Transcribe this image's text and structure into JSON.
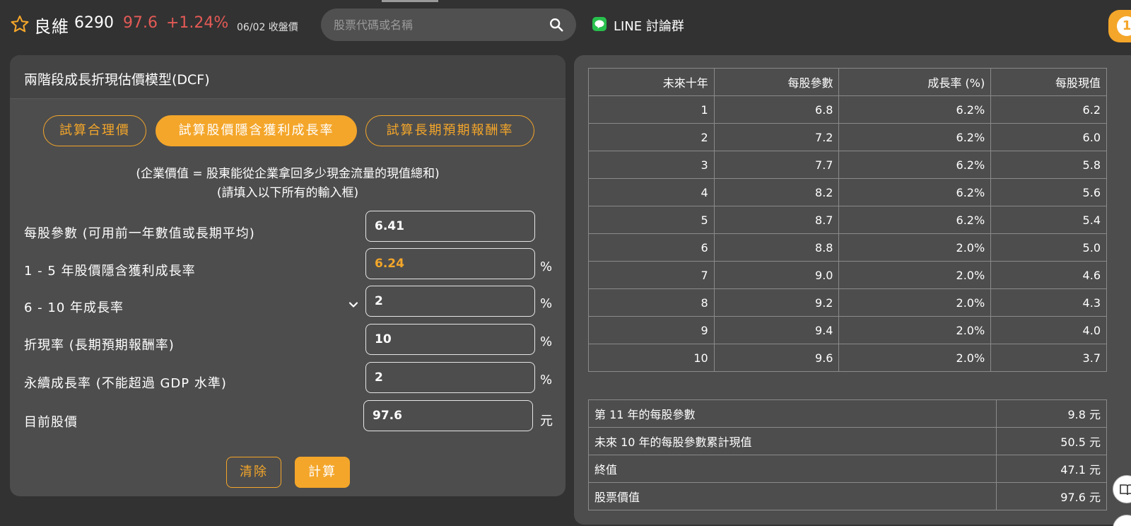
{
  "header": {
    "stock_name": "良維",
    "stock_code": "6290",
    "price": "97.6",
    "change": "+1.24%",
    "close_date": "06/02 收盤價",
    "search_placeholder": "股票代碼或名稱",
    "line_label": "LINE 討論群",
    "badge": "1",
    "price_color": "#e35a56",
    "accent_color": "#f4a62a"
  },
  "model": {
    "title": "兩階段成長折現估價模型(DCF)",
    "tabs": [
      {
        "label": "試算合理價",
        "active": false
      },
      {
        "label": "試算股價隱含獲利成長率",
        "active": true
      },
      {
        "label": "試算長期預期報酬率",
        "active": false
      }
    ],
    "description_1": "(企業價值 = 股東能從企業拿回多少現金流量的現值總和)",
    "description_2": "(請填入以下所有的輸入框)",
    "fields": [
      {
        "label": "每股參數 (可用前一年數值或長期平均)",
        "value": "6.41",
        "unit": ""
      },
      {
        "label": "1 - 5 年股價隱含獲利成長率",
        "value": "6.24",
        "unit": "%"
      },
      {
        "label": "6 - 10 年成長率",
        "value": "2",
        "unit": "%"
      },
      {
        "label": "折現率 (長期預期報酬率)",
        "value": "10",
        "unit": "%"
      },
      {
        "label": "永續成長率 (不能超過 GDP 水準)",
        "value": "2",
        "unit": "%"
      },
      {
        "label": "目前股價",
        "value": "97.6",
        "unit": "元"
      }
    ],
    "clear_label": "清除",
    "calc_label": "計算"
  },
  "table": {
    "headers": [
      "未來十年",
      "每股參數",
      "成長率 (%)",
      "每股現值"
    ],
    "rows": [
      [
        "1",
        "6.8",
        "6.2%",
        "6.2"
      ],
      [
        "2",
        "7.2",
        "6.2%",
        "6.0"
      ],
      [
        "3",
        "7.7",
        "6.2%",
        "5.8"
      ],
      [
        "4",
        "8.2",
        "6.2%",
        "5.6"
      ],
      [
        "5",
        "8.7",
        "6.2%",
        "5.4"
      ],
      [
        "6",
        "8.8",
        "2.0%",
        "5.0"
      ],
      [
        "7",
        "9.0",
        "2.0%",
        "4.6"
      ],
      [
        "8",
        "9.2",
        "2.0%",
        "4.3"
      ],
      [
        "9",
        "9.4",
        "2.0%",
        "4.0"
      ],
      [
        "10",
        "9.6",
        "2.0%",
        "3.7"
      ]
    ]
  },
  "summary": [
    {
      "label": "第 11 年的每股參數",
      "value": "9.8 元"
    },
    {
      "label": "未來 10 年的每股參數累計現值",
      "value": "50.5 元"
    },
    {
      "label": "終值",
      "value": "47.1 元"
    },
    {
      "label": "股票價值",
      "value": "97.6 元"
    }
  ]
}
